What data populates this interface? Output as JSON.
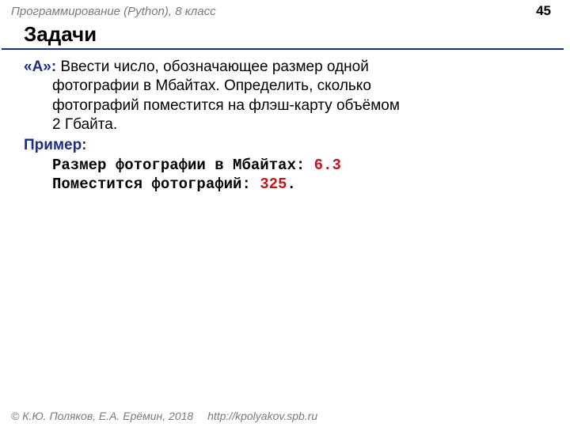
{
  "header": {
    "course": "Программирование (Python), 8 класс",
    "page": "45"
  },
  "title": "Задачи",
  "task": {
    "label": "«A»: ",
    "line1_rest": "Ввести число, обозначающее размер одной",
    "line2": "фотографии в Мбайтах. Определить, сколько",
    "line3": "фотографий поместится на флэш-карту объёмом",
    "line4": "2 Гбайта."
  },
  "example": {
    "label": "Пример:",
    "l1_prompt": "Размер фотографии в Мбайтах: ",
    "l1_value": "6.3",
    "l2_prompt": "Поместится фотографий: ",
    "l2_value": "325",
    "l2_tail": "."
  },
  "footer": {
    "copyright": "© К.Ю. Поляков, Е.А. Ерёмин, 2018",
    "url": "http://kpolyakov.spb.ru"
  }
}
